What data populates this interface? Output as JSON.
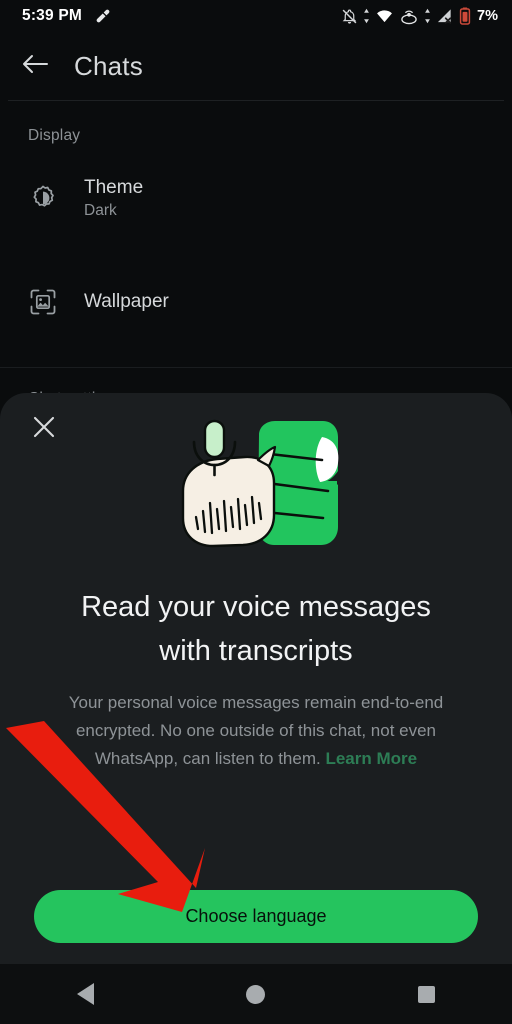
{
  "status_bar": {
    "time": "5:39 PM",
    "battery_percent": "7%",
    "icons": [
      "tag-icon",
      "notifications-off-icon",
      "wifi-icon",
      "hotspot-icon",
      "signal-no-service-icon",
      "battery-low-icon"
    ]
  },
  "app_bar": {
    "back_label": "back-arrow",
    "title": "Chats"
  },
  "settings": {
    "display_section_title": "Display",
    "rows": [
      {
        "label": "Theme",
        "value": "Dark",
        "icon": "brightness-icon"
      },
      {
        "label": "Wallpaper",
        "value": "",
        "icon": "wallpaper-icon"
      }
    ],
    "chat_settings_section_title": "Chat settings"
  },
  "sheet": {
    "close_label": "close",
    "illustration": "voice-transcript-illustration",
    "title": "Read your voice messages with transcripts",
    "body_text": "Your personal voice messages remain end-to-end encrypted. No one outside of this chat, not even WhatsApp, can listen to them. ",
    "learn_more": "Learn More",
    "primary_button": "Choose language"
  },
  "annotation": {
    "arrow": "red-arrow-pointing-to-choose-language"
  },
  "nav_bar": {
    "back": "back",
    "home": "home",
    "recents": "recents"
  },
  "colors": {
    "accent_green": "#25c45e",
    "link_green": "#2d7d55",
    "sheet_bg": "#1b1e20",
    "page_bg": "#0a0c0d",
    "annotation_red": "#e81d0e"
  }
}
